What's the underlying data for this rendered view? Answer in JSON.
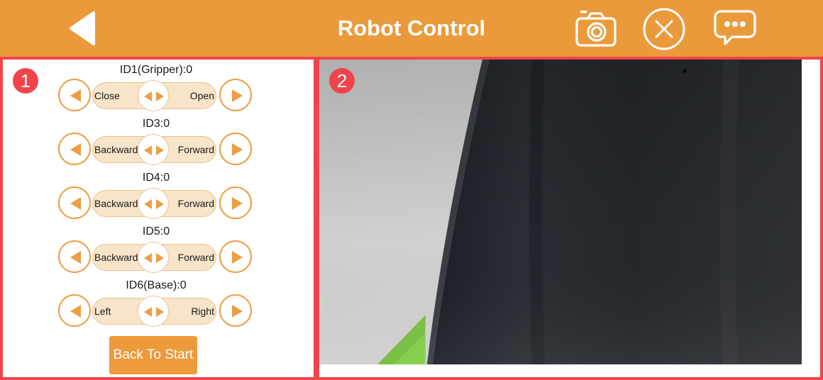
{
  "header": {
    "title": "Robot Control",
    "icons": [
      "back-arrow-icon",
      "camera-icon",
      "close-circle-icon",
      "chat-bubble-icon"
    ],
    "color": "#eb9a3b"
  },
  "left_panel": {
    "badge": "1",
    "joints": [
      {
        "label": "ID1(Gripper):0",
        "left_text": "Close",
        "right_text": "Open"
      },
      {
        "label": "ID3:0",
        "left_text": "Backward",
        "right_text": "Forward"
      },
      {
        "label": "ID4:0",
        "left_text": "Backward",
        "right_text": "Forward"
      },
      {
        "label": "ID5:0",
        "left_text": "Backward",
        "right_text": "Forward"
      },
      {
        "label": "ID6(Base):0",
        "left_text": "Left",
        "right_text": "Right"
      }
    ],
    "back_to_start": "Back To Start"
  },
  "right_panel": {
    "badge": "2"
  },
  "colors": {
    "accent": "#eb9a3b",
    "highlight_border": "#f0444a",
    "slider_track": "#f7e4c9"
  }
}
